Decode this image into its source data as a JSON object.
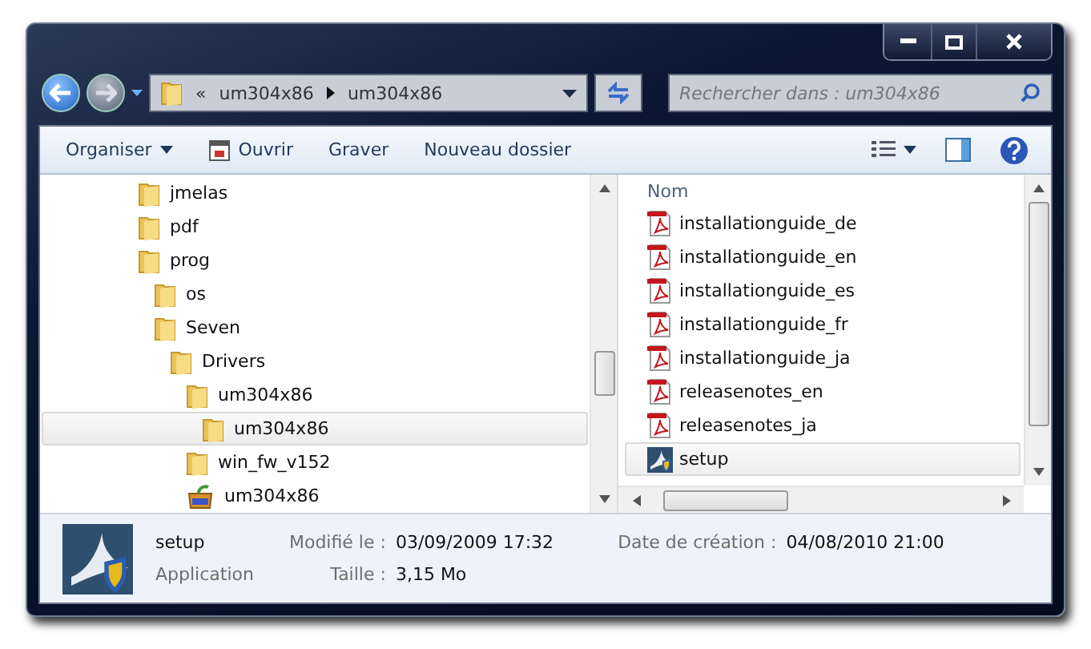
{
  "address_bar": {
    "overflow": "«",
    "crumbs": [
      "um304x86",
      "um304x86"
    ]
  },
  "search": {
    "placeholder": "Rechercher dans : um304x86"
  },
  "toolbar": {
    "buttons": [
      {
        "label": "Organiser",
        "kind": "menu"
      },
      {
        "label": "Ouvrir",
        "kind": "open"
      },
      {
        "label": "Graver",
        "kind": "plain"
      },
      {
        "label": "Nouveau dossier",
        "kind": "plain"
      }
    ]
  },
  "tree": [
    {
      "label": "jmelas",
      "kind": "folder",
      "selected": false
    },
    {
      "label": "pdf",
      "kind": "folder",
      "selected": false
    },
    {
      "label": "prog",
      "kind": "folder",
      "selected": false,
      "children": [
        {
          "label": "os",
          "kind": "folder",
          "selected": false
        },
        {
          "label": "Seven",
          "kind": "folder",
          "selected": false,
          "children": [
            {
              "label": "Drivers",
              "kind": "folder",
              "selected": false,
              "children": [
                {
                  "label": "um304x86",
                  "kind": "folder",
                  "selected": false,
                  "children": [
                    {
                      "label": "um304x86",
                      "kind": "folder",
                      "selected": true
                    }
                  ]
                },
                {
                  "label": "win_fw_v152",
                  "kind": "folder",
                  "selected": false
                },
                {
                  "label": "um304x86",
                  "kind": "zip",
                  "selected": false
                }
              ]
            }
          ]
        }
      ]
    }
  ],
  "files": {
    "column": "Nom",
    "items": [
      {
        "name": "installationguide_de",
        "kind": "pdf",
        "selected": false
      },
      {
        "name": "installationguide_en",
        "kind": "pdf",
        "selected": false
      },
      {
        "name": "installationguide_es",
        "kind": "pdf",
        "selected": false
      },
      {
        "name": "installationguide_fr",
        "kind": "pdf",
        "selected": false
      },
      {
        "name": "installationguide_ja",
        "kind": "pdf",
        "selected": false
      },
      {
        "name": "releasenotes_en",
        "kind": "pdf",
        "selected": false
      },
      {
        "name": "releasenotes_ja",
        "kind": "pdf",
        "selected": false
      },
      {
        "name": "setup",
        "kind": "app",
        "selected": true
      }
    ]
  },
  "details": {
    "name": "setup",
    "type": "Application",
    "fields": [
      {
        "label": "Modifié le :",
        "value": "03/09/2009 17:32"
      },
      {
        "label": "Taille :",
        "value": "3,15 Mo"
      },
      {
        "label": "Date de création :",
        "value": "04/08/2010 21:00"
      }
    ]
  }
}
